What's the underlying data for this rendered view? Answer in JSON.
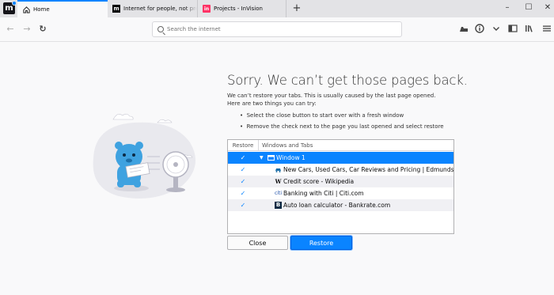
{
  "tabs": [
    {
      "label": "Home",
      "favicon": "firefox-home-icon"
    },
    {
      "label": "Internet for people, not profit — Mo",
      "favicon": "mozilla-m-icon"
    },
    {
      "label": "Projects - InVision",
      "favicon": "invision-in-icon"
    }
  ],
  "new_tab_glyph": "+",
  "window_controls": {
    "minimize": "–",
    "maximize": "☐",
    "close": "✕"
  },
  "nav": {
    "back_glyph": "←",
    "forward_glyph": "→",
    "reload_glyph": "↻",
    "search_placeholder": "Search the internet"
  },
  "toolbar_icons": [
    "library-shelf-icon",
    "info-circle-icon",
    "chevron-down-icon",
    "sidebar-icon",
    "bookmarks-library-icon",
    "hamburger-menu-icon"
  ],
  "page": {
    "title": "Sorry. We can’t get those pages back.",
    "intro_line1": "We can’t restore your tabs. This is usually caused by the last page opened.",
    "intro_line2": "Here are two things you can try:",
    "bullet1": "Select the close button to start over with a fresh window",
    "bullet2": "Remove the check next to the page you last opened and select restore"
  },
  "tree": {
    "col_restore": "Restore",
    "col_windows": "Windows and Tabs",
    "window_label": "Window 1",
    "rows": [
      {
        "title": "New Cars, Used Cars, Car Reviews and Pricing | Edmunds",
        "checked": true,
        "icon": "edmunds-car-icon"
      },
      {
        "title": "Credit score - Wikipedia",
        "checked": true,
        "icon": "wikipedia-w-icon"
      },
      {
        "title": "Banking with Citi | Citi.com",
        "checked": true,
        "icon": "citi-icon"
      },
      {
        "title": "Auto loan calculator - Bankrate.com",
        "checked": true,
        "icon": "bankrate-b-icon"
      }
    ],
    "check_glyph": "✓"
  },
  "buttons": {
    "close": "Close",
    "restore": "Restore"
  },
  "colors": {
    "accent": "#0a84ff",
    "tabstrip": "#e3e3e6",
    "page_bg": "#f9f9fa"
  }
}
